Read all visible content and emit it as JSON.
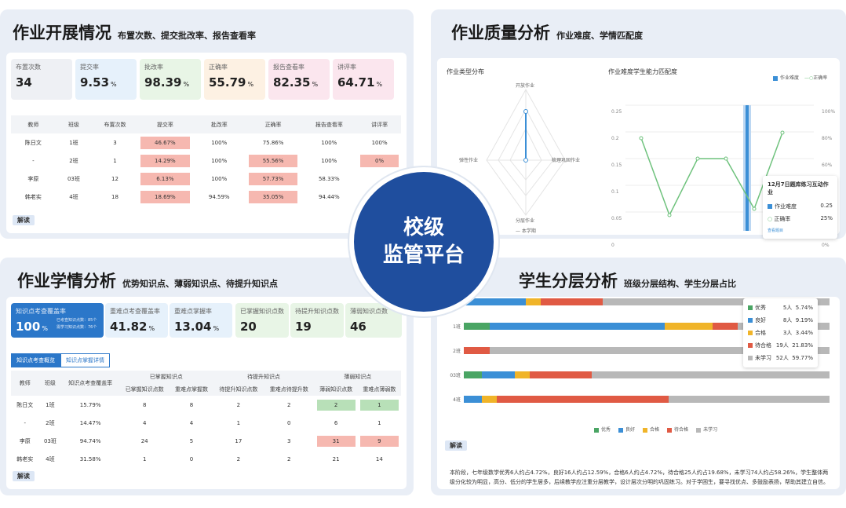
{
  "q1": {
    "title": "作业开展情况",
    "subtitle": "布置次数、提交批改率、报告查看率",
    "stats": [
      {
        "label": "布置次数",
        "value": "34",
        "unit": "",
        "bg": "#eef0f4"
      },
      {
        "label": "提交率",
        "value": "9.53",
        "unit": "%",
        "bg": "#e6f1fb"
      },
      {
        "label": "批改率",
        "value": "98.39",
        "unit": "%",
        "bg": "#e8f5e6"
      },
      {
        "label": "正确率",
        "value": "55.79",
        "unit": "%",
        "bg": "#fdf1e3"
      },
      {
        "label": "报告查看率",
        "value": "82.35",
        "unit": "%",
        "bg": "#fbe6ee"
      },
      {
        "label": "讲评率",
        "value": "64.71",
        "unit": "%",
        "bg": "#fbe6ee"
      }
    ],
    "headers": [
      "教师",
      "班级",
      "布置次数",
      "提交率",
      "批改率",
      "正确率",
      "报告查看率",
      "讲评率"
    ],
    "rows": [
      [
        "陈日文",
        "1班",
        "3",
        "46.67%",
        "100%",
        "75.86%",
        "100%",
        "100%"
      ],
      [
        "-",
        "2班",
        "1",
        "14.29%",
        "100%",
        "55.56%",
        "100%",
        "0%"
      ],
      [
        "李原",
        "03班",
        "12",
        "6.13%",
        "100%",
        "57.73%",
        "58.33%",
        ""
      ],
      [
        "韩老实",
        "4班",
        "18",
        "18.69%",
        "94.59%",
        "35.05%",
        "94.44%",
        ""
      ]
    ],
    "jiedu": "解读"
  },
  "q2": {
    "title": "作业质量分析",
    "subtitle": "作业难度、学情匹配度",
    "radar_title": "作业类型分布",
    "radar_axes": [
      "开放作业",
      "梳理巩固作业",
      "分层作业",
      "弹性作业"
    ],
    "radar_legend": "本学期",
    "line_title": "作业难度学生能力匹配度",
    "legend": [
      "作业难度",
      "正确率"
    ],
    "yleft": [
      "0.25",
      "0.2",
      "0.15",
      "0.1",
      "0.05",
      "0"
    ],
    "yright": [
      "100%",
      "80%",
      "60%",
      "40%",
      "20%",
      "0%"
    ],
    "tooltip": {
      "title": "12月7日题库练习互动作业",
      "r1": "作业难度",
      "v1": "0.25",
      "r2": "正确率",
      "v2": "25%",
      "link": "查看题目"
    }
  },
  "q3": {
    "title": "作业学情分析",
    "subtitle": "优势知识点、薄弱知识点、待提升知识点",
    "stats": [
      {
        "label": "知识点考查覆盖率",
        "value": "100",
        "unit": "%",
        "extra1": "已考查知识点数：85个",
        "extra2": "需学习知识点数：76个",
        "bg": "#2b77c9",
        "dark": true
      },
      {
        "label": "重难点考查覆盖率",
        "value": "41.82",
        "unit": "%",
        "bg": "#e6f1fb"
      },
      {
        "label": "重难点掌握率",
        "value": "13.04",
        "unit": "%",
        "bg": "#e6f1fb"
      },
      {
        "label": "已掌握知识点数",
        "value": "20",
        "unit": "",
        "bg": "#e8f5e6"
      },
      {
        "label": "待提升知识点数",
        "value": "19",
        "unit": "",
        "bg": "#e8f5e6"
      },
      {
        "label": "薄弱知识点数",
        "value": "46",
        "unit": "",
        "bg": "#e8f5e6"
      }
    ],
    "tabs": [
      "知识点考查概览",
      "知识点掌握详情"
    ],
    "group_headers": [
      "已掌握知识点",
      "待提升知识点",
      "薄弱知识点"
    ],
    "headers": [
      "教师",
      "班级",
      "知识点考查覆盖率",
      "已掌握知识点数",
      "重难点掌握数",
      "待提升知识点数",
      "重难点待提升数",
      "薄弱知识点数",
      "重难点薄弱数"
    ],
    "rows": [
      [
        "陈日文",
        "1班",
        "15.79%",
        "8",
        "8",
        "2",
        "2",
        "2",
        "1"
      ],
      [
        "-",
        "2班",
        "14.47%",
        "4",
        "4",
        "1",
        "0",
        "6",
        "1"
      ],
      [
        "李原",
        "03班",
        "94.74%",
        "24",
        "5",
        "17",
        "3",
        "31",
        "9"
      ],
      [
        "韩老实",
        "4班",
        "31.58%",
        "1",
        "0",
        "2",
        "2",
        "21",
        "14"
      ]
    ],
    "jiedu": "解读"
  },
  "q4": {
    "title": "学生分层分析",
    "subtitle": "班级分层结构、学生分层占比",
    "legend": [
      {
        "name": "优秀",
        "color": "#4aa564"
      },
      {
        "name": "良好",
        "color": "#3b8fd6"
      },
      {
        "name": "合格",
        "color": "#f0b429"
      },
      {
        "name": "待合格",
        "color": "#e05a44"
      },
      {
        "name": "未学习",
        "color": "#b8b8b8"
      }
    ],
    "popup": [
      {
        "name": "优秀",
        "count": "5人",
        "pct": "5.74%"
      },
      {
        "name": "良好",
        "count": "8人",
        "pct": "9.19%"
      },
      {
        "name": "合格",
        "count": "3人",
        "pct": "3.44%"
      },
      {
        "name": "待合格",
        "count": "19人",
        "pct": "21.83%"
      },
      {
        "name": "未学习",
        "count": "52人",
        "pct": "59.77%"
      }
    ],
    "bars": [
      {
        "label": "",
        "seg": [
          0,
          0.17,
          0.04,
          0.17,
          0.62
        ]
      },
      {
        "label": "1班",
        "seg": [
          0.07,
          0.48,
          0.13,
          0.07,
          0.25
        ]
      },
      {
        "label": "2班",
        "seg": [
          0,
          0,
          0,
          0.07,
          0.93
        ]
      },
      {
        "label": "03班",
        "seg": [
          0.05,
          0.09,
          0.04,
          0.17,
          0.65
        ]
      },
      {
        "label": "4班",
        "seg": [
          0,
          0.05,
          0.04,
          0.47,
          0.44
        ]
      }
    ],
    "jiedu": "解读",
    "desc": "本阶段，七年级数学优秀6人约占4.72%，良好16人约占12.59%，合格6人约占4.72%，待合格25人约占19.68%，未学习74人约占58.26%，学生整体两级分化较为明显，高分、低分的学生居多，后续教学应注重分层教学，设计层次分明的巩固练习。对于学困生，要寻找优点、多鼓励表扬，帮助其建立自信。"
  },
  "center": {
    "line1": "校级",
    "line2": "监管平台"
  }
}
